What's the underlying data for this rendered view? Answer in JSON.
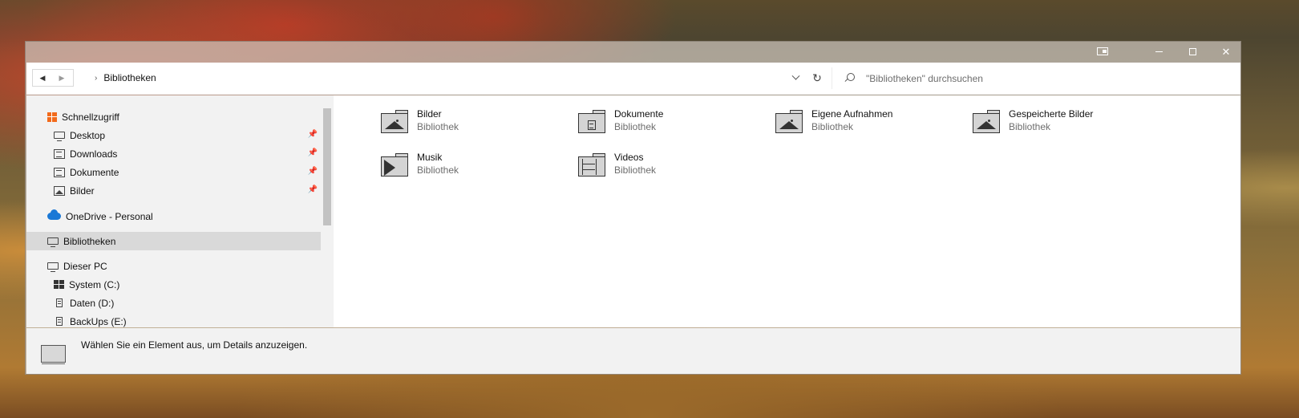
{
  "window": {
    "controls": {
      "snap_icon": "snap-layout-icon",
      "minimize_icon": "minimize-icon",
      "maximize_icon": "maximize-icon",
      "close_icon": "close-icon",
      "close_glyph": "✕"
    }
  },
  "addressbar": {
    "back_glyph": "◀",
    "forward_glyph": "▶",
    "separator_glyph": "›",
    "breadcrumb": "Bibliotheken",
    "refresh_glyph": "↻",
    "search_placeholder": "\"Bibliotheken\" durchsuchen"
  },
  "sidebar": {
    "quick_access": {
      "label": "Schnellzugriff",
      "icon": "star-icon"
    },
    "pinned": [
      {
        "label": "Desktop",
        "icon": "desktop-icon",
        "pin": "📌"
      },
      {
        "label": "Downloads",
        "icon": "downloads-icon",
        "pin": "📌"
      },
      {
        "label": "Dokumente",
        "icon": "documents-icon",
        "pin": "📌"
      },
      {
        "label": "Bilder",
        "icon": "pictures-icon",
        "pin": "📌"
      }
    ],
    "onedrive": {
      "label": "OneDrive - Personal",
      "icon": "cloud-icon"
    },
    "libraries": {
      "label": "Bibliotheken",
      "icon": "libraries-icon",
      "selected": true
    },
    "this_pc": {
      "label": "Dieser PC",
      "icon": "computer-icon"
    },
    "drives": [
      {
        "label": "System (C:)",
        "icon": "windows-drive-icon"
      },
      {
        "label": "Daten (D:)",
        "icon": "drive-icon"
      },
      {
        "label": "BackUps (E:)",
        "icon": "drive-icon"
      }
    ]
  },
  "content": {
    "items": [
      {
        "name": "Bilder",
        "type": "Bibliothek",
        "icon": "pictures-library-icon"
      },
      {
        "name": "Dokumente",
        "type": "Bibliothek",
        "icon": "documents-library-icon"
      },
      {
        "name": "Eigene Aufnahmen",
        "type": "Bibliothek",
        "icon": "camera-roll-library-icon"
      },
      {
        "name": "Gespeicherte Bilder",
        "type": "Bibliothek",
        "icon": "saved-pictures-library-icon"
      },
      {
        "name": "Musik",
        "type": "Bibliothek",
        "icon": "music-library-icon"
      },
      {
        "name": "Videos",
        "type": "Bibliothek",
        "icon": "videos-library-icon"
      }
    ]
  },
  "details": {
    "message": "Wählen Sie ein Element aus, um Details anzuzeigen."
  },
  "colors": {
    "selection": "#d9d9d9",
    "quick_access_accent": "#f26a1b",
    "onedrive_accent": "#1a78d6",
    "pane_background": "#f2f2f2"
  }
}
